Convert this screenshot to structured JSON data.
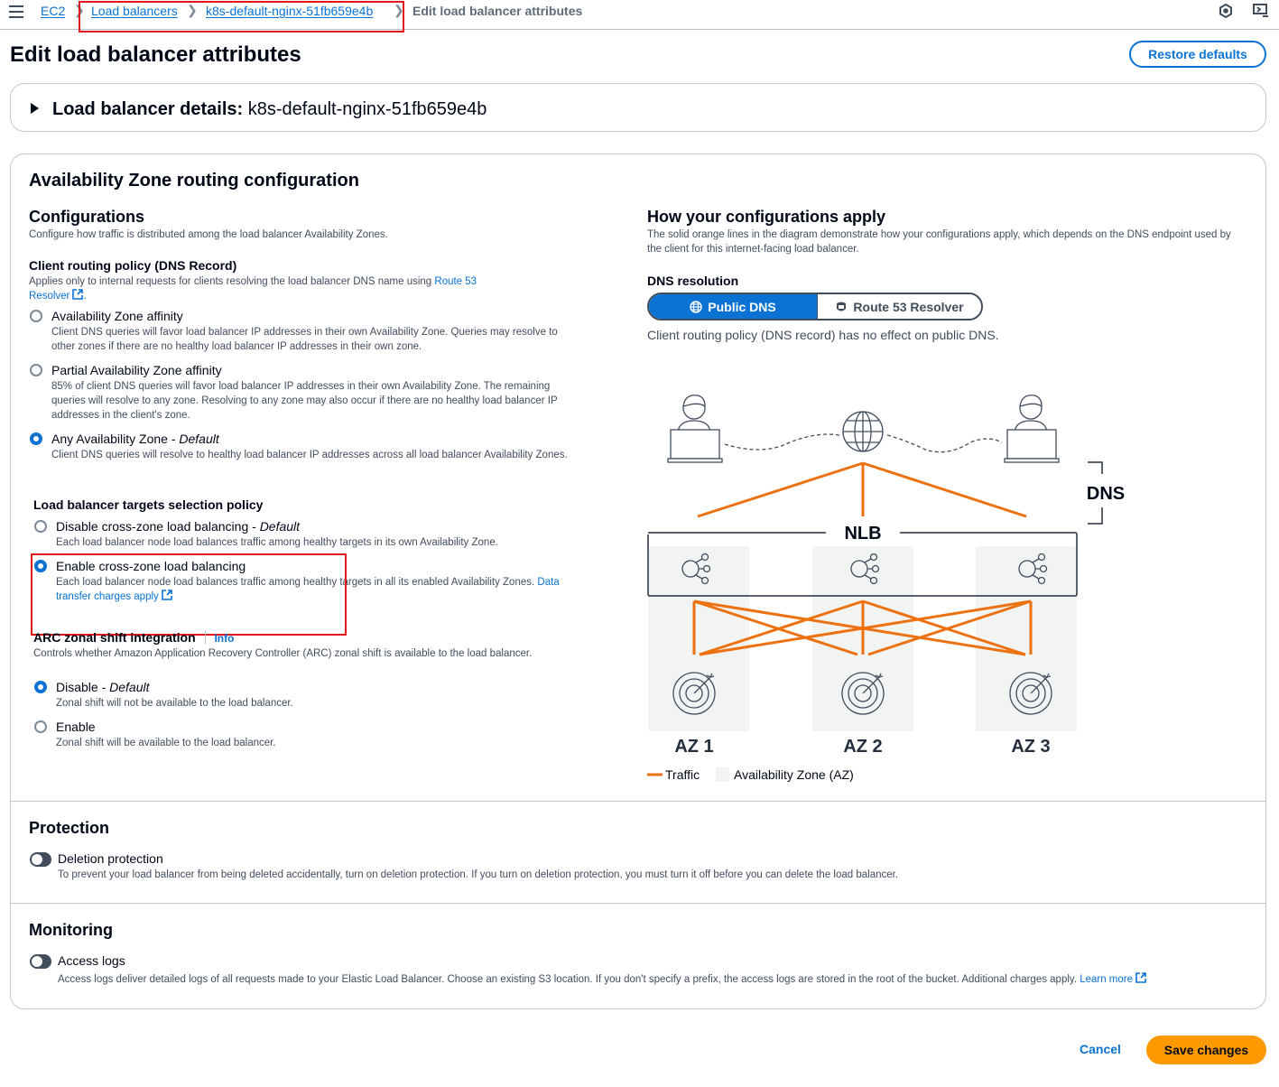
{
  "topbar": {
    "breadcrumbs": [
      {
        "label": "EC2",
        "link": true
      },
      {
        "label": "Load balancers",
        "link": true
      },
      {
        "label": "k8s-default-nginx-51fb659e4b",
        "link": true
      },
      {
        "label": "Edit load balancer attributes",
        "link": false
      }
    ]
  },
  "header": {
    "title": "Edit load balancer attributes",
    "restore_defaults_label": "Restore defaults"
  },
  "details": {
    "label": "Load balancer details:",
    "name": "k8s-default-nginx-51fb659e4b"
  },
  "az_routing": {
    "title": "Availability Zone routing configuration",
    "configurations": {
      "title": "Configurations",
      "description": "Configure how traffic is distributed among the load balancer Availability Zones."
    },
    "client_routing": {
      "title": "Client routing policy (DNS Record)",
      "description": "Applies only to internal requests for clients resolving the load balancer DNS name using",
      "link_part1": "Route 53",
      "link_part2": "Resolver",
      "options": [
        {
          "label": "Availability Zone affinity",
          "suffix": "",
          "checked": false,
          "description": "Client DNS queries will favor load balancer IP addresses in their own Availability Zone. Queries may resolve to other zones if there are no healthy load balancer IP addresses in their own zone."
        },
        {
          "label": "Partial Availability Zone affinity",
          "suffix": "",
          "checked": false,
          "description": "85% of client DNS queries will favor load balancer IP addresses in their own Availability Zone. The remaining queries will resolve to any zone. Resolving to any zone may also occur if there are no healthy load balancer IP addresses in the client's zone."
        },
        {
          "label": "Any Availability Zone - ",
          "suffix": "Default",
          "checked": true,
          "description": "Client DNS queries will resolve to healthy load balancer IP addresses across all load balancer Availability Zones."
        }
      ]
    },
    "targets_selection": {
      "title": "Load balancer targets selection policy",
      "options": [
        {
          "label": "Disable cross-zone load balancing - ",
          "suffix": "Default",
          "checked": false,
          "description": "Each load balancer node load balances traffic among healthy targets in its own Availability Zone."
        },
        {
          "label": "Enable cross-zone load balancing",
          "suffix": "",
          "checked": true,
          "description": "Each load balancer node load balances traffic among healthy targets in all its enabled Availability Zones.",
          "link": "Data transfer charges apply"
        }
      ]
    },
    "arc": {
      "title": "ARC zonal shift integration",
      "info": "Info",
      "description": "Controls whether Amazon Application Recovery Controller (ARC) zonal shift is available to the load balancer.",
      "options": [
        {
          "label": "Disable - ",
          "suffix": "Default",
          "checked": true,
          "description": "Zonal shift will not be available to the load balancer."
        },
        {
          "label": "Enable",
          "suffix": "",
          "checked": false,
          "description": "Zonal shift will be available to the load balancer."
        }
      ]
    },
    "how_apply": {
      "title": "How your configurations apply",
      "description": "The solid orange lines in the diagram demonstrate how your configurations apply, which depends on the DNS endpoint used by the client for this internet-facing load balancer.",
      "dns_resolution_label": "DNS resolution",
      "segments": [
        {
          "label": "Public DNS",
          "icon": "globe-icon",
          "active": true
        },
        {
          "label": "Route 53 Resolver",
          "icon": "route53-icon",
          "active": false
        }
      ],
      "note": "Client routing policy (DNS record) has no effect on public DNS."
    },
    "diagram": {
      "dns_label": "DNS",
      "nlb_label": "NLB",
      "zones": [
        "AZ 1",
        "AZ 2",
        "AZ 3"
      ],
      "legend": {
        "traffic": "Traffic",
        "az": "Availability Zone (AZ)"
      },
      "traffic_color": "#ec7211"
    }
  },
  "protection": {
    "title": "Protection",
    "toggle_label": "Deletion protection",
    "toggle_on": false,
    "description": "To prevent your load balancer from being deleted accidentally, turn on deletion protection. If you turn on deletion protection, you must turn it off before you can delete the load balancer."
  },
  "monitoring": {
    "title": "Monitoring",
    "toggle_label": "Access logs",
    "toggle_on": false,
    "description": "Access logs deliver detailed logs of all requests made to your Elastic Load Balancer. Choose an existing S3 location. If you don't specify a prefix, the access logs are stored in the root of the bucket. Additional charges apply.",
    "link": "Learn more"
  },
  "footer": {
    "cancel_label": "Cancel",
    "save_label": "Save changes"
  }
}
